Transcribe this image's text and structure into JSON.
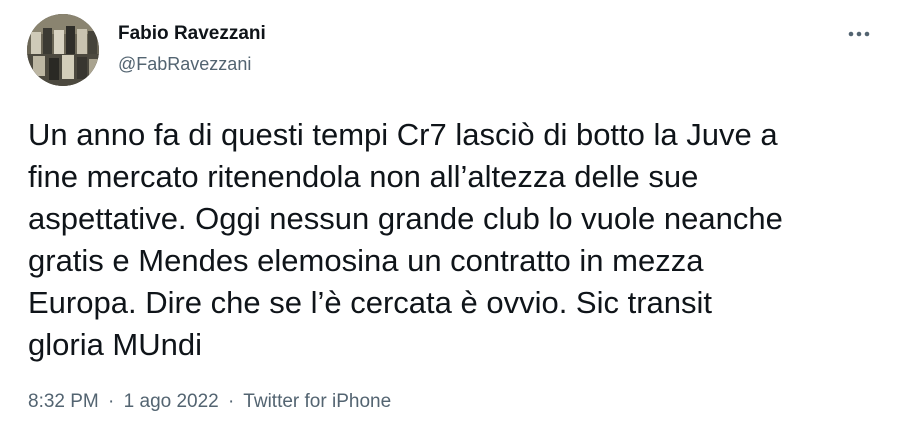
{
  "author": {
    "display_name": "Fabio Ravezzani",
    "handle": "@FabRavezzani",
    "avatar_icon": "profile-photo"
  },
  "menu": {
    "icon": "more-horizontal-icon"
  },
  "tweet": {
    "lines": [
      "Un anno fa di questi tempi Cr7 lasciò di botto la Juve a",
      "fine mercato ritenendola non all’altezza delle sue",
      "aspettative. Oggi nessun grande club lo vuole neanche",
      "gratis e Mendes elemosina un contratto in mezza",
      "Europa. Dire che se l’è cercata è ovvio. Sic transit",
      "gloria MUndi"
    ]
  },
  "meta": {
    "time": "8:32 PM",
    "separator": "·",
    "date": "1 ago 2022",
    "source": "Twitter for iPhone"
  },
  "colors": {
    "text_primary": "#0f1419",
    "text_secondary": "#536471",
    "background": "#ffffff"
  }
}
